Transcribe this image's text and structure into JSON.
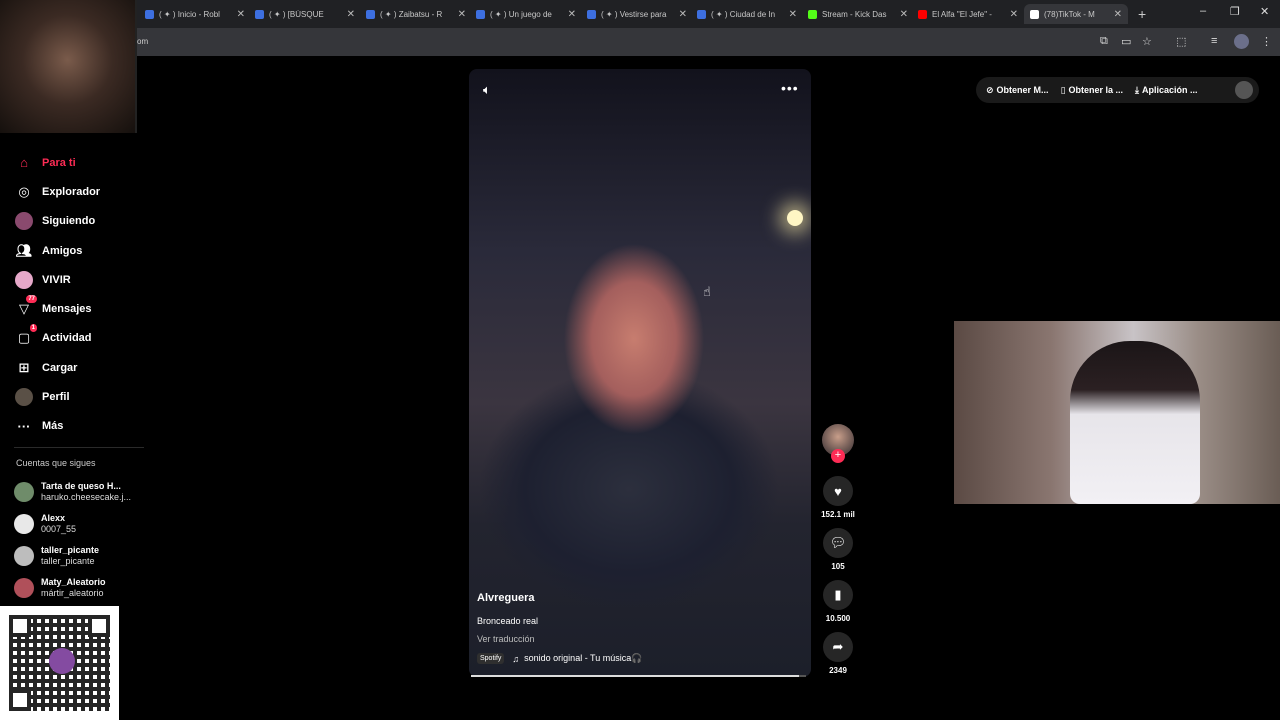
{
  "browser": {
    "tabs": [
      {
        "title": "( ✦ ) Inicio - Robl",
        "color": "#3d6fe0"
      },
      {
        "title": "( ✦ ) [BÚSQUE",
        "color": "#3d6fe0"
      },
      {
        "title": "( ✦ ) Zaibatsu - R",
        "color": "#3d6fe0"
      },
      {
        "title": "( ✦ ) Un juego de",
        "color": "#3d6fe0"
      },
      {
        "title": "( ✦ ) Vestirse para",
        "color": "#3d6fe0"
      },
      {
        "title": "( ✦ ) Ciudad de In",
        "color": "#3d6fe0"
      },
      {
        "title": "Stream - Kick Das",
        "color": "#53fc18"
      },
      {
        "title": "El Alfa \"El Jefe\" -",
        "color": "#ff0000"
      },
      {
        "title": "(78)TikTok - M",
        "color": "#ffffff"
      }
    ],
    "new_tab": "+",
    "address_fragment": "om"
  },
  "sidebar": {
    "items": [
      {
        "label": "Para ti",
        "icon": "home-icon"
      },
      {
        "label": "Explorador",
        "icon": "compass-icon"
      },
      {
        "label": "Siguiendo",
        "icon": "following-icon"
      },
      {
        "label": "Amigos",
        "icon": "friends-icon"
      },
      {
        "label": "VIVIR",
        "icon": "live-icon"
      },
      {
        "label": "Mensajes",
        "icon": "messages-icon",
        "badge": "77"
      },
      {
        "label": "Actividad",
        "icon": "activity-icon",
        "badge": "1"
      },
      {
        "label": "Cargar",
        "icon": "upload-icon"
      },
      {
        "label": "Perfil",
        "icon": "profile-icon"
      },
      {
        "label": "Más",
        "icon": "more-icon"
      }
    ],
    "following_heading": "Cuentas que sigues",
    "following": [
      {
        "name": "Tarta de queso H...",
        "handle": "haruko.cheesecake.j..."
      },
      {
        "name": "Alexx",
        "handle": "0007_55"
      },
      {
        "name": "taller_picante",
        "handle": "taller_picante"
      },
      {
        "name": "Maty_Aleatorio",
        "handle": "mártir_aleatorio"
      }
    ]
  },
  "header": {
    "obtain_coins": "Obtener M...",
    "obtain_app": "Obtener la ...",
    "app": "Aplicación ..."
  },
  "video": {
    "author": "Alvreguera",
    "caption": "Bronceado real",
    "translate": "Ver traducción",
    "spotify_label": "Spotify",
    "music": "sonido original - Tu música🎧",
    "progress": 0.98
  },
  "actions": {
    "likes": "152.1 mil",
    "comments": "105",
    "saves": "10.500",
    "shares": "2349"
  },
  "colors": {
    "accent": "#fe2c55",
    "background": "#000000"
  }
}
